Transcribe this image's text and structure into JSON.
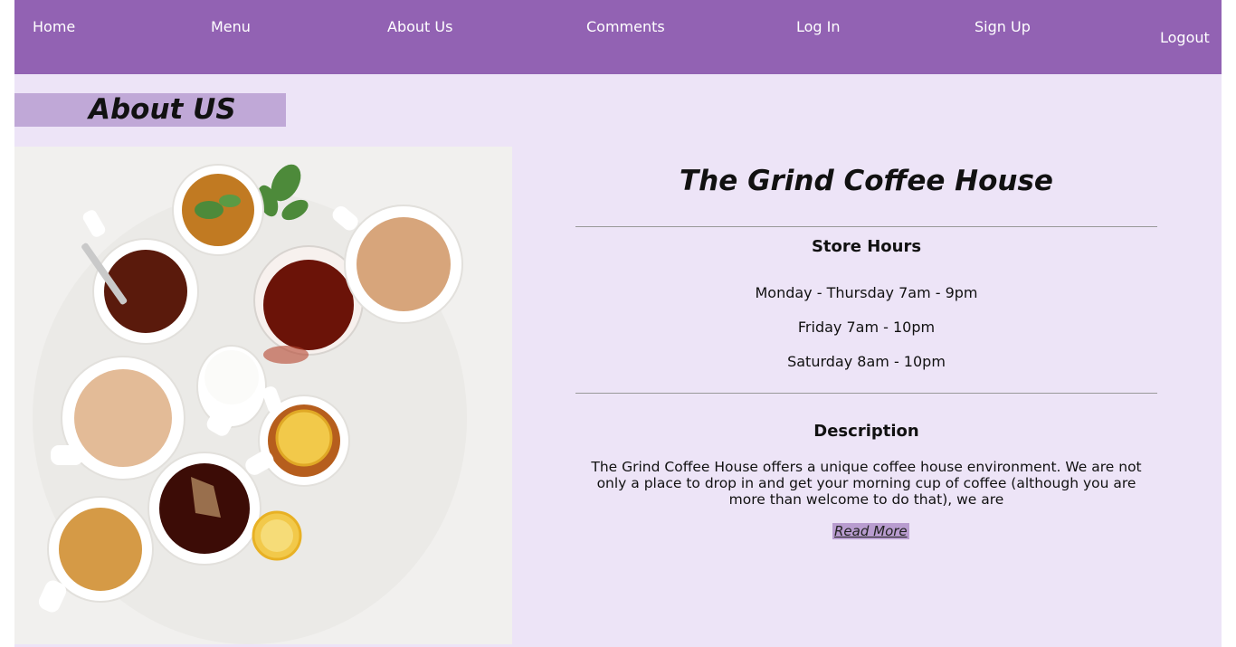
{
  "nav": {
    "home": "Home",
    "menu": "Menu",
    "about": "About Us",
    "comments": "Comments",
    "login": "Log In",
    "signup": "Sign Up",
    "logout": "Logout"
  },
  "about": {
    "title": "About US"
  },
  "photo": {
    "subject": "cups of tea and coffee with milk jug, lemon slices and mint"
  },
  "info": {
    "name": "The Grind Coffee House",
    "hours_heading": "Store Hours",
    "hours": [
      "Monday - Thursday 7am - 9pm",
      "Friday 7am - 10pm",
      "Saturday 8am - 10pm"
    ],
    "description_heading": "Description",
    "description": "The Grind Coffee House offers a unique coffee house environment. We are not only a place to drop in and get your morning cup of coffee (although you are more than welcome to do that), we are",
    "read_more": "Read More"
  },
  "colors": {
    "nav_bg": "#9262b3",
    "page_bg": "#ede4f7",
    "title_bar_bg": "#c0a8d7",
    "read_more_bg": "#b89ccf"
  }
}
